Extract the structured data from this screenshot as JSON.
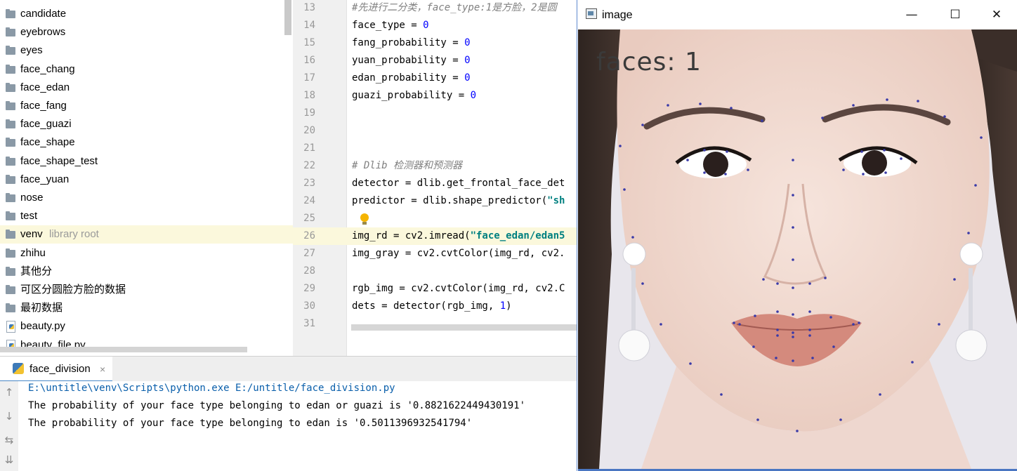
{
  "project_tree": {
    "items": [
      {
        "label": "candidate",
        "type": "folder"
      },
      {
        "label": "eyebrows",
        "type": "folder"
      },
      {
        "label": "eyes",
        "type": "folder"
      },
      {
        "label": "face_chang",
        "type": "folder"
      },
      {
        "label": "face_edan",
        "type": "folder"
      },
      {
        "label": "face_fang",
        "type": "folder"
      },
      {
        "label": "face_guazi",
        "type": "folder"
      },
      {
        "label": "face_shape",
        "type": "folder"
      },
      {
        "label": "face_shape_test",
        "type": "folder"
      },
      {
        "label": "face_yuan",
        "type": "folder"
      },
      {
        "label": "nose",
        "type": "folder"
      },
      {
        "label": "test",
        "type": "folder"
      },
      {
        "label": "venv",
        "suffix": "library root",
        "type": "folder"
      },
      {
        "label": "zhihu",
        "type": "folder"
      },
      {
        "label": "其他分",
        "type": "folder"
      },
      {
        "label": "可区分圆脸方脸的数据",
        "type": "folder"
      },
      {
        "label": "最初数据",
        "type": "folder"
      },
      {
        "label": "beauty.py",
        "type": "python-file"
      },
      {
        "label": "beauty_file.py",
        "type": "python-file"
      }
    ]
  },
  "editor": {
    "lines": [
      {
        "n": "13",
        "text": "#先进行二分类，face_type:1是方脸，2是圆",
        "kind": "comment"
      },
      {
        "n": "14",
        "pre": "face_type = ",
        "num": "0"
      },
      {
        "n": "15",
        "pre": "fang_probability = ",
        "num": "0"
      },
      {
        "n": "16",
        "pre": "yuan_probability = ",
        "num": "0"
      },
      {
        "n": "17",
        "pre": "edan_probability = ",
        "num": "0"
      },
      {
        "n": "18",
        "pre": "guazi_probability = ",
        "num": "0"
      },
      {
        "n": "19",
        "pre": ""
      },
      {
        "n": "20",
        "pre": ""
      },
      {
        "n": "21",
        "pre": ""
      },
      {
        "n": "22",
        "text": "# Dlib 检测器和预测器",
        "kind": "comment"
      },
      {
        "n": "23",
        "pre": "detector = dlib.get_frontal_face_det"
      },
      {
        "n": "24",
        "pre": "predictor = dlib.shape_predictor(",
        "str": "\"sh"
      },
      {
        "n": "25",
        "pre": ""
      },
      {
        "n": "26",
        "pre": "img_rd = cv2.imread(",
        "str": "\"face_edan/edan5",
        "current": true
      },
      {
        "n": "27",
        "pre": "img_gray = cv2.cvtColor(img_rd, cv2."
      },
      {
        "n": "28",
        "pre": ""
      },
      {
        "n": "29",
        "pre": "rgb_img = cv2.cvtColor(img_rd, cv2.C"
      },
      {
        "n": "30",
        "pre": "dets = detector(rgb_img, ",
        "num": "1",
        "post": ")"
      },
      {
        "n": "31",
        "pre": ""
      }
    ]
  },
  "run_panel": {
    "tab_label": "face_division",
    "close_glyph": "×",
    "console_lines": [
      "E:\\untitle\\venv\\Scripts\\python.exe E:/untitle/face_division.py",
      "The probability of your face type belonging to edan or guazi is '0.8821622449430191'",
      "The probability of your face type belonging to edan is '0.5011396932541794'"
    ]
  },
  "image_window": {
    "title": "image",
    "faces_text": "faces: 1",
    "minimize_glyph": "—",
    "maximize_glyph": "☐",
    "close_glyph": "✕"
  },
  "colors": {
    "accent_blue": "#4a88c7",
    "comment_gray": "#808080",
    "number_blue": "#0000ff",
    "string_teal": "#008080",
    "current_line": "#fbf8dc"
  }
}
